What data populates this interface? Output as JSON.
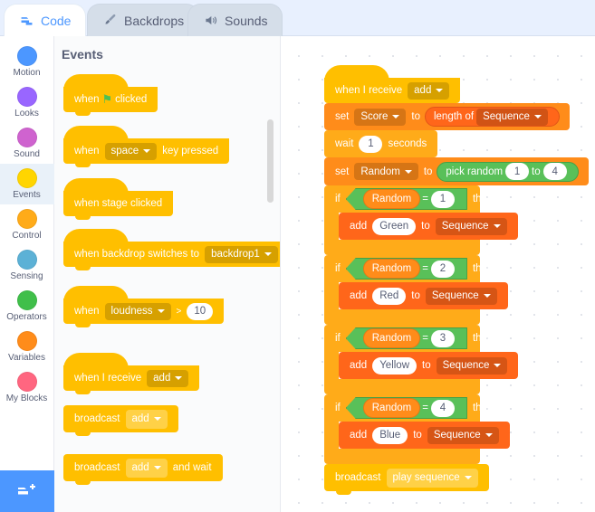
{
  "tabs": [
    {
      "label": "Code",
      "icon": "code-icon",
      "active": true
    },
    {
      "label": "Backdrops",
      "icon": "paintbrush-icon",
      "active": false
    },
    {
      "label": "Sounds",
      "icon": "speaker-icon",
      "active": false
    }
  ],
  "categories": [
    {
      "label": "Motion",
      "color": "#4c97ff",
      "selected": false
    },
    {
      "label": "Looks",
      "color": "#9966ff",
      "selected": false
    },
    {
      "label": "Sound",
      "color": "#cf63cf",
      "selected": false
    },
    {
      "label": "Events",
      "color": "#ffd500",
      "selected": true
    },
    {
      "label": "Control",
      "color": "#ffab19",
      "selected": false
    },
    {
      "label": "Sensing",
      "color": "#5cb1d6",
      "selected": false
    },
    {
      "label": "Operators",
      "color": "#40bf4a",
      "selected": false
    },
    {
      "label": "Variables",
      "color": "#ff8c1a",
      "selected": false
    },
    {
      "label": "My Blocks",
      "color": "#ff6680",
      "selected": false
    }
  ],
  "add_extension": {
    "icon": "add-extension-icon"
  },
  "palette": {
    "title": "Events",
    "blocks": {
      "flag_when": "when",
      "flag_clicked": "clicked",
      "key_when": "when",
      "key_value": "space",
      "key_pressed": "key pressed",
      "stage_clicked": "when stage clicked",
      "backdrop_text": "when backdrop switches to",
      "backdrop_value": "backdrop1",
      "loud_when": "when",
      "loud_value": "loudness",
      "loud_op": ">",
      "loud_number": "10",
      "receive_text": "when I receive",
      "receive_value": "add",
      "broadcast_text": "broadcast",
      "broadcast_value": "add",
      "broadcast_wait_text": "broadcast",
      "broadcast_wait_value": "add",
      "broadcast_wait_suffix": "and wait"
    }
  },
  "script": {
    "hat": {
      "text": "when I receive",
      "message": "add"
    },
    "set_score": {
      "set": "set",
      "variable": "Score",
      "to": "to",
      "reporter": "length of",
      "list": "Sequence"
    },
    "wait": {
      "wait": "wait",
      "seconds_value": "1",
      "seconds": "seconds"
    },
    "set_random": {
      "set": "set",
      "variable": "Random",
      "to": "to",
      "reporter": "pick random",
      "from": "1",
      "to_word": "to",
      "until": "4"
    },
    "conditions": [
      {
        "if": "if",
        "variable": "Random",
        "operator": "=",
        "value": "1",
        "then": "then",
        "add": "add",
        "item": "Green",
        "to": "to",
        "list": "Sequence"
      },
      {
        "if": "if",
        "variable": "Random",
        "operator": "=",
        "value": "2",
        "then": "then",
        "add": "add",
        "item": "Red",
        "to": "to",
        "list": "Sequence"
      },
      {
        "if": "if",
        "variable": "Random",
        "operator": "=",
        "value": "3",
        "then": "then",
        "add": "add",
        "item": "Yellow",
        "to": "to",
        "list": "Sequence"
      },
      {
        "if": "if",
        "variable": "Random",
        "operator": "=",
        "value": "4",
        "then": "then",
        "add": "add",
        "item": "Blue",
        "to": "to",
        "list": "Sequence"
      }
    ],
    "broadcast": {
      "text": "broadcast",
      "message": "play sequence"
    }
  }
}
